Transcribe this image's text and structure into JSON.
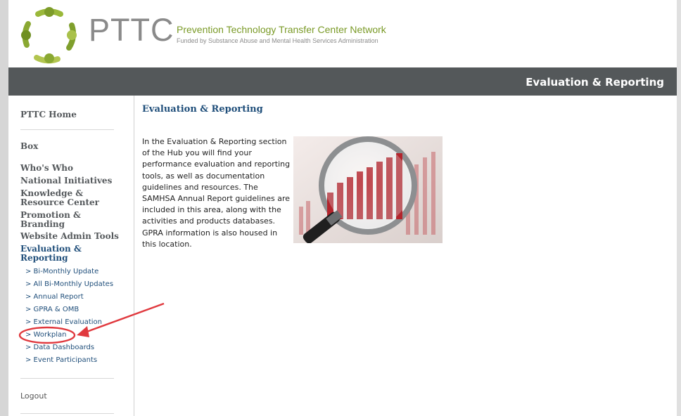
{
  "header": {
    "brand": "PTTC",
    "org_name": "Prevention Technology Transfer Center Network",
    "org_subtitle": "Funded by Substance Abuse and Mental Health Services Administration",
    "logo_icon": "circle-of-people-logo-icon",
    "brand_color": "#7a9a27"
  },
  "banner": {
    "title": "Evaluation & Reporting",
    "color": "#54585a"
  },
  "sidebar": {
    "home": "PTTC Home",
    "box": "Box",
    "items": [
      "Who's Who",
      "National Initiatives",
      "Knowledge & Resource Center",
      "Promotion & Branding",
      "Website Admin Tools",
      "Evaluation & Reporting"
    ],
    "subitems": [
      "> Bi-Monthly Update",
      "> All Bi-Monthly Updates",
      "> Annual Report",
      "> GPRA & OMB",
      "> External Evaluation",
      "> Workplan",
      "> Data Dashboards",
      "> Event Participants"
    ],
    "logout": "Logout",
    "active_color": "#1f4e7a"
  },
  "main": {
    "title": "Evaluation & Reporting",
    "body": "In the Evaluation & Reporting section of the Hub you will find your performance evaluation and reporting tools, as well as documentation guidelines and resources. The SAMHSA Annual Report guidelines are included in this area, along with the activities and products databases. GPRA information is also housed in this location.",
    "image_icon": "magnifying-glass-over-bar-chart-image"
  },
  "annotation": {
    "color": "#e0393e",
    "target": "Workplan"
  }
}
